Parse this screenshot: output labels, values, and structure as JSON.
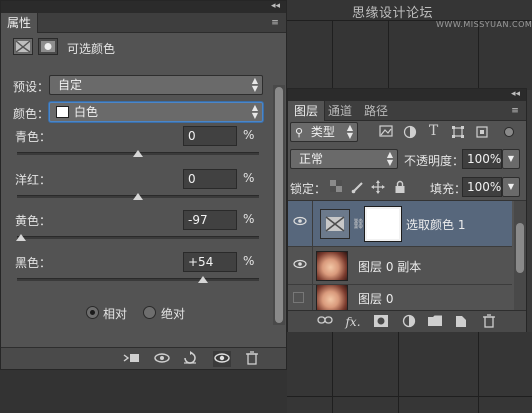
{
  "watermark": {
    "text": "思缘设计论坛",
    "site": "WWW.MISSYUAN.COM"
  },
  "properties_panel": {
    "tab_label": "属性",
    "collapse_glyph": "◂◂",
    "menu_glyph": "≡",
    "adjustment_title": "可选颜色",
    "preset_label": "预设：",
    "preset_value": "自定",
    "colors_label": "颜色：",
    "colors_value": "白色",
    "sliders": [
      {
        "label": "青色：",
        "value": "0",
        "unit": "%",
        "level_percent": 0
      },
      {
        "label": "洋红：",
        "value": "0",
        "unit": "%",
        "level_percent": 0
      },
      {
        "label": "黄色：",
        "value": "-97",
        "unit": "%",
        "level_percent": -97
      },
      {
        "label": "黑色：",
        "value": "+54",
        "unit": "%",
        "level_percent": 54
      }
    ],
    "method_options": [
      {
        "label": "相对",
        "selected": true
      },
      {
        "label": "绝对",
        "selected": false
      }
    ],
    "toolbar_icons": [
      "clip-to-layer-icon",
      "view-previous-icon",
      "reset-icon",
      "visibility-icon",
      "trash-icon"
    ]
  },
  "layers_panel": {
    "tabs": [
      "图层",
      "通道",
      "路径"
    ],
    "active_tab": "图层",
    "collapse_glyph": "◂◂",
    "menu_glyph": "≡",
    "filter_label": "类型",
    "filter_icons": [
      "image-filter-icon",
      "adjustment-filter-icon",
      "text-filter-icon",
      "shape-filter-icon",
      "smart-object-filter-icon"
    ],
    "blend_mode": "正常",
    "opacity_label": "不透明度：",
    "opacity_value": "100%",
    "lock_label": "锁定：",
    "fill_label": "填充：",
    "fill_value": "100%",
    "layers": [
      {
        "name": "选取颜色 1",
        "type": "adjustment",
        "visible": true,
        "selected": true
      },
      {
        "name": "图层 0 副本",
        "type": "photo",
        "visible": true,
        "selected": false
      },
      {
        "name": "图层 0",
        "type": "photo",
        "visible": false,
        "selected": false
      }
    ],
    "toolbar_icons": [
      "link-icon",
      "fx-icon",
      "mask-icon",
      "adjustment-layer-icon",
      "folder-icon",
      "new-layer-icon",
      "trash-icon"
    ],
    "fx_label": "fx."
  },
  "colors": {
    "panel_bg": "#535353",
    "selection_blue": "#57677c",
    "focus_blue": "#4b86c8"
  }
}
